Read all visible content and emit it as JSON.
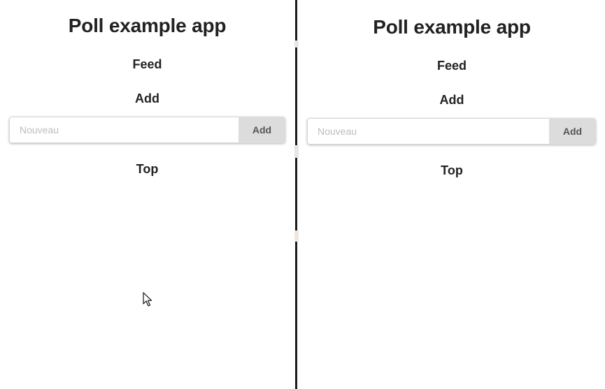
{
  "app": {
    "title": "Poll example app",
    "nav": {
      "feed": "Feed",
      "add": "Add",
      "top": "Top"
    },
    "add_form": {
      "placeholder": "Nouveau",
      "value": "",
      "button_label": "Add"
    }
  },
  "colors": {
    "text": "#222222",
    "divider": "#1c1c1c",
    "button_bg": "#dcdcdc",
    "placeholder": "#bdbdbd"
  }
}
